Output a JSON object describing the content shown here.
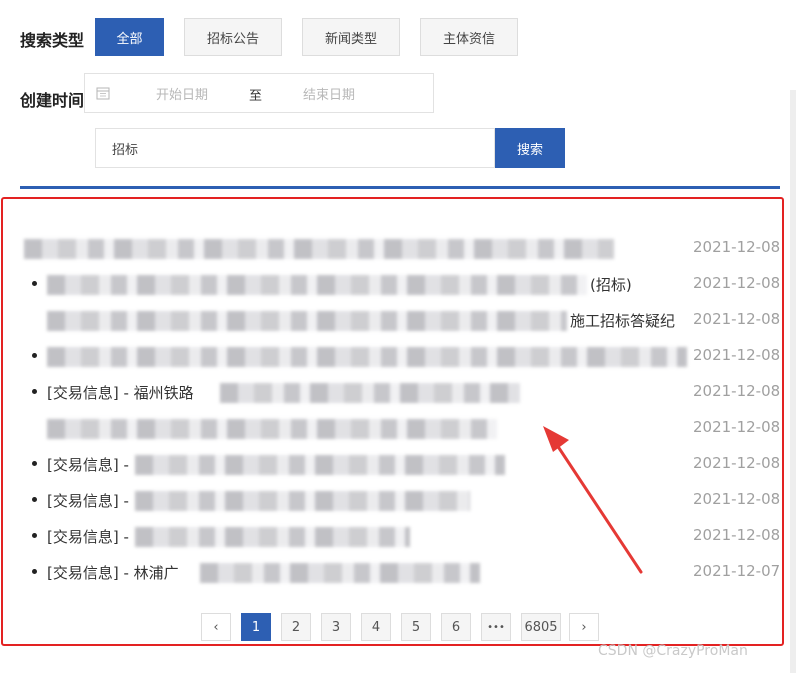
{
  "filters": {
    "type_label": "搜索类型",
    "type_options": [
      "全部",
      "招标公告",
      "新闻类型",
      "主体资信"
    ],
    "time_label": "创建时间",
    "date_start_placeholder": "开始日期",
    "date_separator": "至",
    "date_end_placeholder": "结束日期"
  },
  "search": {
    "value": "招标",
    "button_label": "搜索"
  },
  "news": [
    {
      "title": "",
      "date": "2021-12-08"
    },
    {
      "title": "(招标)",
      "date": "2021-12-08"
    },
    {
      "title": "施工招标答疑纪",
      "date": "2021-12-08"
    },
    {
      "title": "",
      "date": "2021-12-08"
    },
    {
      "title": "[交易信息] - 福州铁路",
      "date": "2021-12-08"
    },
    {
      "title": "",
      "date": "2021-12-08"
    },
    {
      "title": "[交易信息] -",
      "date": "2021-12-08"
    },
    {
      "title": "[交易信息] -",
      "date": "2021-12-08"
    },
    {
      "title": "[交易信息] -",
      "date": "2021-12-08"
    },
    {
      "title": "[交易信息] - 林浦广",
      "date": "2021-12-07"
    }
  ],
  "pagination": {
    "prev": "‹",
    "pages": [
      "1",
      "2",
      "3",
      "4",
      "5",
      "6"
    ],
    "ellipsis": "•••",
    "last": "6805",
    "next": "›",
    "current": "1"
  },
  "watermark": "CSDN @CrazyProMan",
  "colors": {
    "primary": "#2d5fb3",
    "highlight_frame": "#e32222",
    "arrow": "#e53935"
  },
  "icons": {
    "calendar": "calendar-icon",
    "prev": "chevron-left-icon",
    "next": "chevron-right-icon"
  }
}
